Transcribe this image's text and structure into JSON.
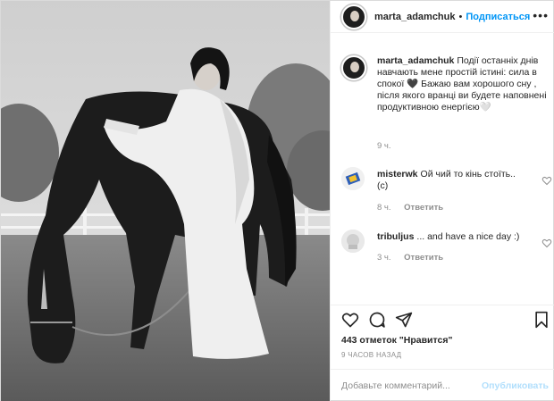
{
  "header": {
    "username": "marta_adamchuk",
    "separator": "•",
    "follow_label": "Подписаться",
    "more_icon": "more-horizontal-icon"
  },
  "caption": {
    "username": "marta_adamchuk",
    "text": "Події останніх днів навчають мене простій істині: сила в спокої 🖤 Бажаю вам хорошого сну , після якого вранці ви будете наповнені продуктивною енергією🤍",
    "time": "9 ч."
  },
  "comments": [
    {
      "username": "misterwk",
      "text": "Ой чий то кінь стоїть.. (с)",
      "time": "8 ч.",
      "reply_label": "Ответить"
    },
    {
      "username": "tribuljus",
      "text": "... and have a nice day :)",
      "time": "3 ч.",
      "reply_label": "Ответить"
    }
  ],
  "actions": {
    "like_icon": "heart-icon",
    "comment_icon": "comment-icon",
    "share_icon": "share-icon",
    "save_icon": "bookmark-icon"
  },
  "likes_text": "443 отметок \"Нравится\"",
  "time_ago": "9 часов назад",
  "add_comment": {
    "placeholder": "Добавьте комментарий...",
    "publish_label": "Опубликовать"
  },
  "colors": {
    "accent": "#0095f6",
    "publish_disabled": "#b2dffc",
    "muted_text": "#8e8e8e",
    "border": "#efefef"
  }
}
